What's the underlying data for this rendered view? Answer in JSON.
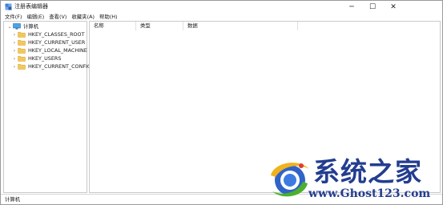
{
  "window": {
    "title": "注册表编辑器",
    "controls": {
      "minimize": "─",
      "maximize": "☐",
      "close": "✕"
    },
    "icon": "registry-editor-icon"
  },
  "menu": [
    "文件(F)",
    "编辑(E)",
    "查看(V)",
    "收藏夹(A)",
    "帮助(H)"
  ],
  "tree": {
    "root": {
      "label": "计算机",
      "expander": "⌄",
      "icon": "computer-icon"
    },
    "keys": [
      {
        "label": "HKEY_CLASSES_ROOT",
        "expander": "›",
        "icon": "folder-icon"
      },
      {
        "label": "HKEY_CURRENT_USER",
        "expander": "›",
        "icon": "folder-icon"
      },
      {
        "label": "HKEY_LOCAL_MACHINE",
        "expander": "›",
        "icon": "folder-icon"
      },
      {
        "label": "HKEY_USERS",
        "expander": "›",
        "icon": "folder-icon"
      },
      {
        "label": "HKEY_CURRENT_CONFIG",
        "expander": "›",
        "icon": "folder-icon"
      }
    ]
  },
  "list": {
    "columns": [
      "名称",
      "类型",
      "数据"
    ]
  },
  "status": {
    "path": "计算机"
  },
  "watermark": {
    "title": "系统之家",
    "url": "www.Ghost123.com"
  },
  "colors": {
    "watermark": "#233d8f",
    "folder": "#f2c75c",
    "selection": "#cce8ff"
  }
}
